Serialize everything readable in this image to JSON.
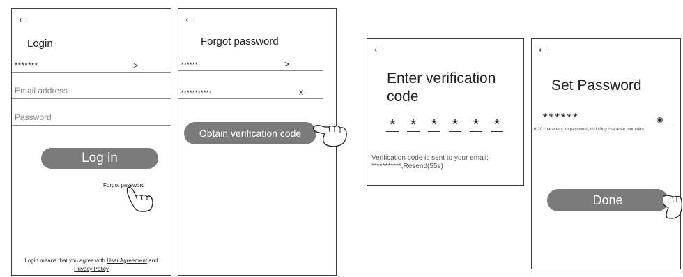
{
  "icons": {
    "back": "←",
    "next": ">",
    "clear": "x",
    "eye": "◉"
  },
  "login": {
    "title": "Login",
    "account_value": "*******",
    "email_placeholder": "Email address",
    "password_placeholder": "Password",
    "login_button": "Log in",
    "forgot_link": "Forgot password",
    "agreement_prefix": "Login means that you agree with ",
    "user_agreement": "User Agreement",
    "agreement_and": " and",
    "privacy_policy": "Privacy Policy"
  },
  "forgot": {
    "title": "Forgot password",
    "account_value": "******",
    "email_value": "***********",
    "obtain_button": "Obtain verification code"
  },
  "verify": {
    "title_line1": "Enter verification",
    "title_line2": "code",
    "code_digits": [
      "*",
      "*",
      "*",
      "*",
      "*",
      "*"
    ],
    "note_line1": "Verification code is sent to your email:",
    "note_line2": "***********,Resend(55s)"
  },
  "setpw": {
    "title": "Set Password",
    "password_value": "******",
    "hint": "6-20 characters for password, including character, numbers",
    "done_button": "Done"
  }
}
